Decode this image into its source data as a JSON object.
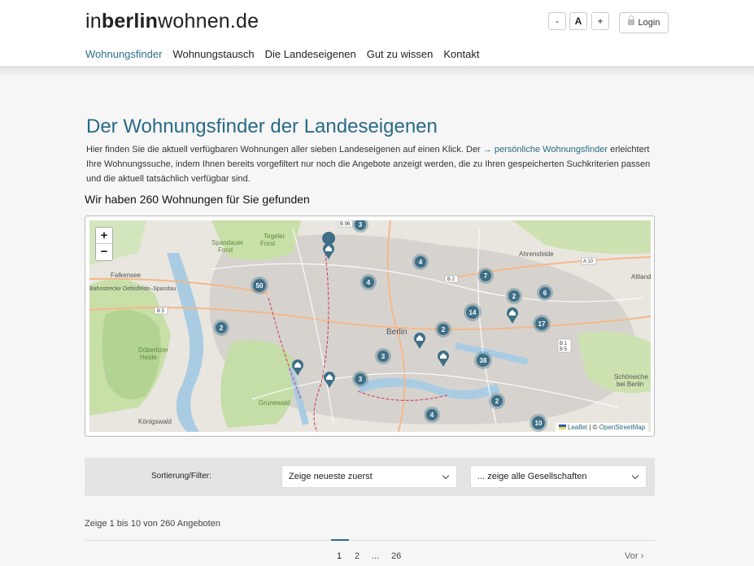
{
  "header": {
    "logo_prefix": "in",
    "logo_bold": "berlin",
    "logo_suffix": "wohnen.de",
    "font_controls": [
      "-",
      "A",
      "+"
    ],
    "login_label": "Login"
  },
  "nav": {
    "items": [
      {
        "label": "Wohnungsfinder",
        "active": true
      },
      {
        "label": "Wohnungstausch"
      },
      {
        "label": "Die Landeseigenen"
      },
      {
        "label": "Gut zu wissen"
      },
      {
        "label": "Kontakt"
      }
    ]
  },
  "main": {
    "title": "Der Wohnungsfinder der Landeseigenen",
    "intro_before": "Hier finden Sie die aktuell verfügbaren Wohnungen aller sieben Landeseigenen auf einen Klick. Der ",
    "intro_link": "→ persönliche Wohnungsfinder",
    "intro_after": " erleichtert Ihre Wohnungssuche, indem Ihnen bereits vorgefiltert nur noch die Angebote anzeigt werden, die zu Ihren gespeicherten Suchkriterien passen und die aktuell tatsächlich verfügbar sind.",
    "found_text": "Wir haben 260 Wohnungen für Sie gefunden"
  },
  "map": {
    "zoom_in": "+",
    "zoom_out": "−",
    "attribution_leaflet": "Leaflet",
    "attribution_sep": " | © ",
    "attribution_osm": "OpenStreetMap",
    "clusters": [
      "3",
      "4",
      "4",
      "50",
      "7",
      "2",
      "6",
      "14",
      "17",
      "2",
      "2",
      "3",
      "38",
      "3",
      "2",
      "4",
      "10"
    ],
    "place_labels": [
      "Falkensee",
      "Berlin",
      "Ahrensfelde",
      "Altland",
      "Schöneiche bei Berlin",
      "Döberitzer Heide",
      "Grunewald",
      "Spandauer Forst",
      "Tegeler Forst",
      "Königswald",
      "B 96",
      "B 2",
      "B 5",
      "A 10",
      "B 1 B 5",
      "Bahnstrecke Oebisfelde–Spandau"
    ],
    "accent_color": "#3e6f86"
  },
  "filters": {
    "label": "Sortierung/Filter:",
    "sort_value": "Zeige neueste zuerst",
    "company_value": "... zeige alle Gesellschaften"
  },
  "results": {
    "count_text": "Zeige 1 bis 10 von 260 Angeboten",
    "pages": [
      "1",
      "2",
      "...",
      "26"
    ],
    "next_label": "Vor"
  }
}
